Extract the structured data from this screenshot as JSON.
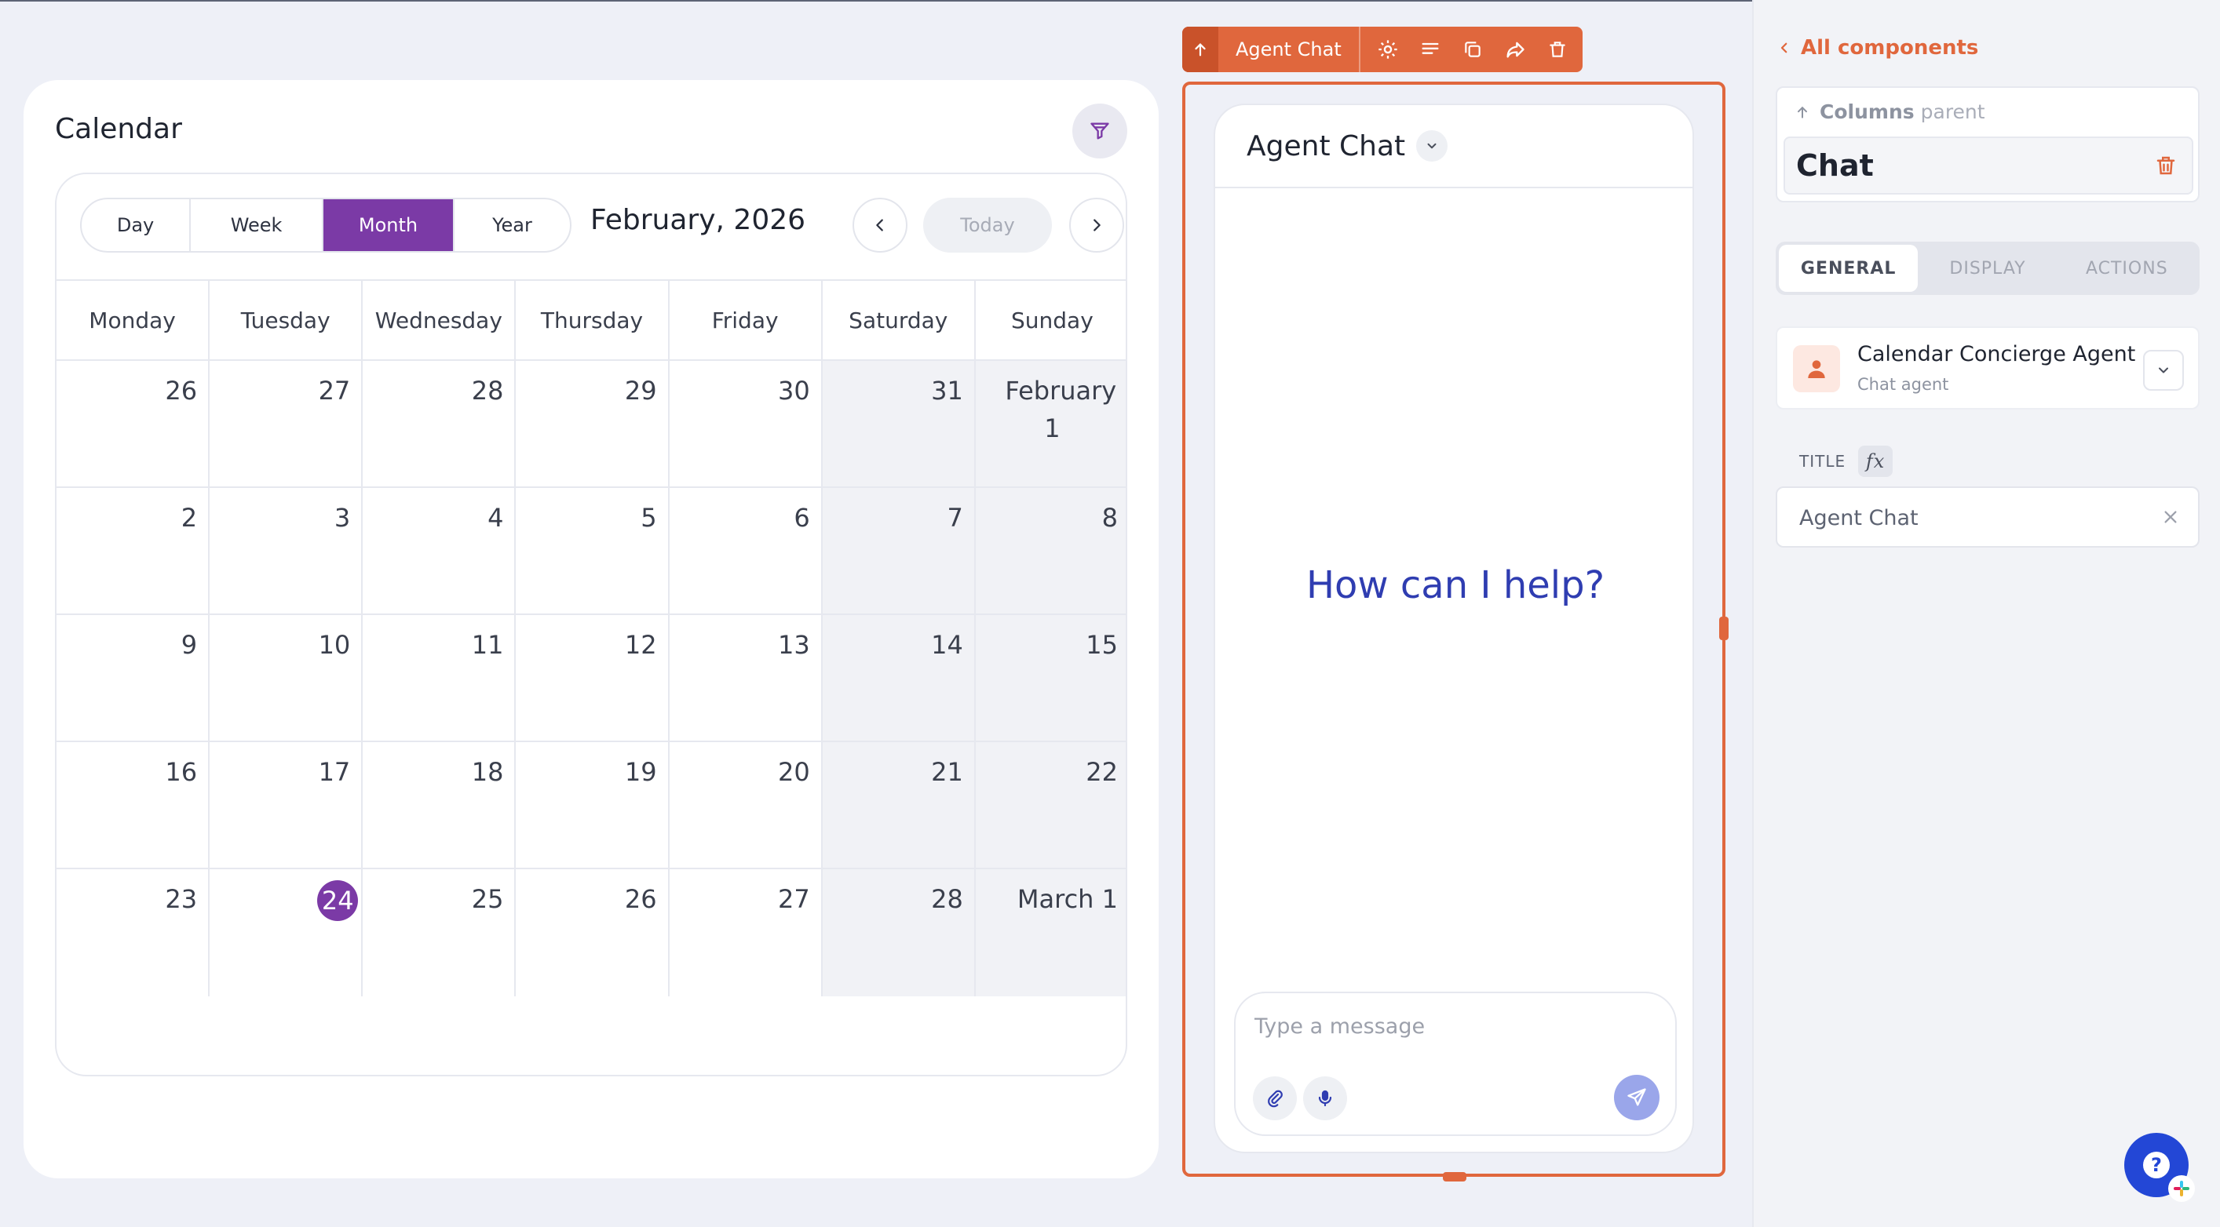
{
  "calendar": {
    "title": "Calendar",
    "views": [
      "Day",
      "Week",
      "Month",
      "Year"
    ],
    "active_view": "Month",
    "month_label": "February, 2026",
    "today_label": "Today",
    "weekdays": [
      "Monday",
      "Tuesday",
      "Wednesday",
      "Thursday",
      "Friday",
      "Saturday",
      "Sunday"
    ],
    "weeks": [
      [
        "26",
        "27",
        "28",
        "29",
        "30",
        "31",
        "February 1"
      ],
      [
        "2",
        "3",
        "4",
        "5",
        "6",
        "7",
        "8"
      ],
      [
        "9",
        "10",
        "11",
        "12",
        "13",
        "14",
        "15"
      ],
      [
        "16",
        "17",
        "18",
        "19",
        "20",
        "21",
        "22"
      ],
      [
        "23",
        "24",
        "25",
        "26",
        "27",
        "28",
        "March 1"
      ]
    ],
    "today_day": "24"
  },
  "widget_toolbar": {
    "label": "Agent Chat"
  },
  "chat": {
    "title": "Agent Chat",
    "empty_prompt": "How can I help?",
    "input_placeholder": "Type a message"
  },
  "panel": {
    "back_link": "All components",
    "parent_name": "Columns",
    "parent_word": "parent",
    "current_component": "Chat",
    "tabs": [
      "GENERAL",
      "DISPLAY",
      "ACTIONS"
    ],
    "active_tab": "GENERAL",
    "agent_name": "Calendar Concierge Agent",
    "agent_type": "Chat agent",
    "title_label": "TITLE",
    "fx_label": "fx",
    "title_value": "Agent Chat"
  },
  "colors": {
    "accent_purple": "#7b3aa6",
    "accent_orange": "#e0673d",
    "prompt_blue": "#2f3db1",
    "help_blue": "#2347d6"
  },
  "help_button": {
    "glyph": "?"
  }
}
